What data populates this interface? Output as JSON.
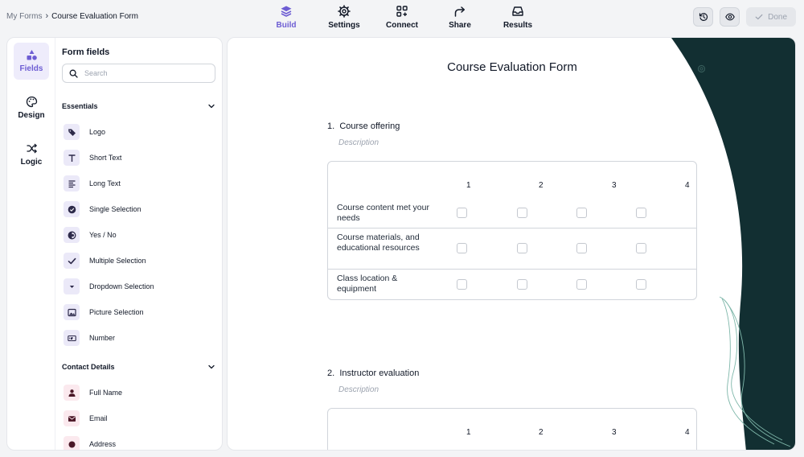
{
  "breadcrumb": {
    "root": "My Forms",
    "separator": "›",
    "current": "Course Evaluation Form"
  },
  "nav": {
    "tabs": [
      {
        "label": "Build",
        "icon": "layers-icon",
        "active": true
      },
      {
        "label": "Settings",
        "icon": "gear-icon",
        "active": false
      },
      {
        "label": "Connect",
        "icon": "integrations-icon",
        "active": false
      },
      {
        "label": "Share",
        "icon": "share-arrow-icon",
        "active": false
      },
      {
        "label": "Results",
        "icon": "inbox-icon",
        "active": false
      }
    ]
  },
  "toolbar": {
    "done_label": "Done",
    "history_icon": "history-icon",
    "preview_icon": "eye-icon"
  },
  "rail": {
    "items": [
      {
        "label": "Fields",
        "icon": "shapes-icon",
        "active": true
      },
      {
        "label": "Design",
        "icon": "palette-icon",
        "active": false
      },
      {
        "label": "Logic",
        "icon": "shuffle-icon",
        "active": false
      }
    ]
  },
  "fields_panel": {
    "title": "Form fields",
    "search_placeholder": "Search",
    "sections": [
      {
        "title": "Essentials",
        "items": [
          {
            "label": "Logo",
            "icon": "tag-icon"
          },
          {
            "label": "Short Text",
            "icon": "text-t-icon"
          },
          {
            "label": "Long Text",
            "icon": "paragraph-icon"
          },
          {
            "label": "Single Selection",
            "icon": "radio-check-icon"
          },
          {
            "label": "Yes / No",
            "icon": "toggle-half-icon"
          },
          {
            "label": "Multiple Selection",
            "icon": "checkmark-icon"
          },
          {
            "label": "Dropdown Selection",
            "icon": "dropdown-icon"
          },
          {
            "label": "Picture Selection",
            "icon": "picture-icon"
          },
          {
            "label": "Number",
            "icon": "number-icon"
          }
        ]
      },
      {
        "title": "Contact Details",
        "items": [
          {
            "label": "Full Name",
            "icon": "person-icon"
          },
          {
            "label": "Email",
            "icon": "envelope-icon"
          },
          {
            "label": "Address",
            "icon": "location-icon"
          }
        ]
      }
    ]
  },
  "form": {
    "title": "Course Evaluation Form",
    "questions": [
      {
        "number": "1.",
        "title": "Course offering",
        "description_placeholder": "Description",
        "columns": [
          "1",
          "2",
          "3",
          "4"
        ],
        "rows": [
          "Course content met your needs",
          "Course materials, and educational resources",
          "Class location & equipment"
        ]
      },
      {
        "number": "2.",
        "title": "Instructor evaluation",
        "description_placeholder": "Description",
        "columns": [
          "1",
          "2",
          "3",
          "4"
        ],
        "rows": []
      }
    ]
  },
  "colors": {
    "accent": "#6d5dd3",
    "deco_dark": "#122f32",
    "deco_line": "#7fb7aa"
  }
}
